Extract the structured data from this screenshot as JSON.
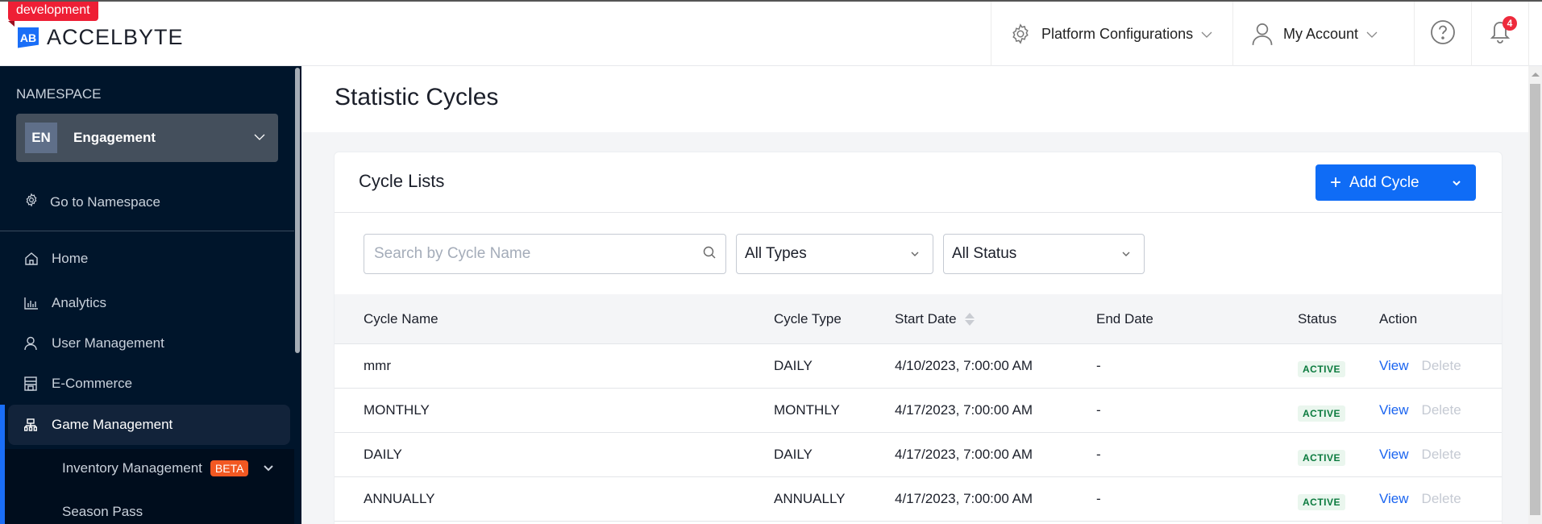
{
  "env_tag": "development",
  "brand": {
    "mark": "AB",
    "name": "ACCELBYTE"
  },
  "topbar": {
    "platform_configurations": "Platform Configurations",
    "my_account": "My Account",
    "notification_count": "4"
  },
  "sidebar": {
    "namespace_label": "NAMESPACE",
    "namespace": {
      "abbr": "EN",
      "name": "Engagement"
    },
    "go_to_namespace": "Go to Namespace",
    "items": [
      {
        "label": "Home",
        "icon": "home-icon"
      },
      {
        "label": "Analytics",
        "icon": "bar-chart-icon"
      },
      {
        "label": "User Management",
        "icon": "user-icon"
      },
      {
        "label": "E-Commerce",
        "icon": "store-icon"
      },
      {
        "label": "Game Management",
        "icon": "sitemap-icon",
        "active": true
      }
    ],
    "sub_items": [
      {
        "label": "Inventory Management",
        "badge": "BETA"
      },
      {
        "label": "Season Pass"
      }
    ]
  },
  "page": {
    "title": "Statistic Cycles",
    "card_title": "Cycle Lists",
    "add_button": "Add Cycle",
    "search_placeholder": "Search by Cycle Name",
    "type_filter": "All Types",
    "status_filter": "All Status"
  },
  "table": {
    "columns": [
      "Cycle Name",
      "Cycle Type",
      "Start Date",
      "End Date",
      "Status",
      "Action"
    ],
    "rows": [
      {
        "name": "mmr",
        "type": "DAILY",
        "start": "4/10/2023, 7:00:00 AM",
        "end": "-",
        "status": "ACTIVE"
      },
      {
        "name": "MONTHLY",
        "type": "MONTHLY",
        "start": "4/17/2023, 7:00:00 AM",
        "end": "-",
        "status": "ACTIVE"
      },
      {
        "name": "DAILY",
        "type": "DAILY",
        "start": "4/17/2023, 7:00:00 AM",
        "end": "-",
        "status": "ACTIVE"
      },
      {
        "name": "ANNUALLY",
        "type": "ANNUALLY",
        "start": "4/17/2023, 7:00:00 AM",
        "end": "-",
        "status": "ACTIVE"
      }
    ],
    "actions": {
      "view": "View",
      "delete": "Delete"
    }
  }
}
